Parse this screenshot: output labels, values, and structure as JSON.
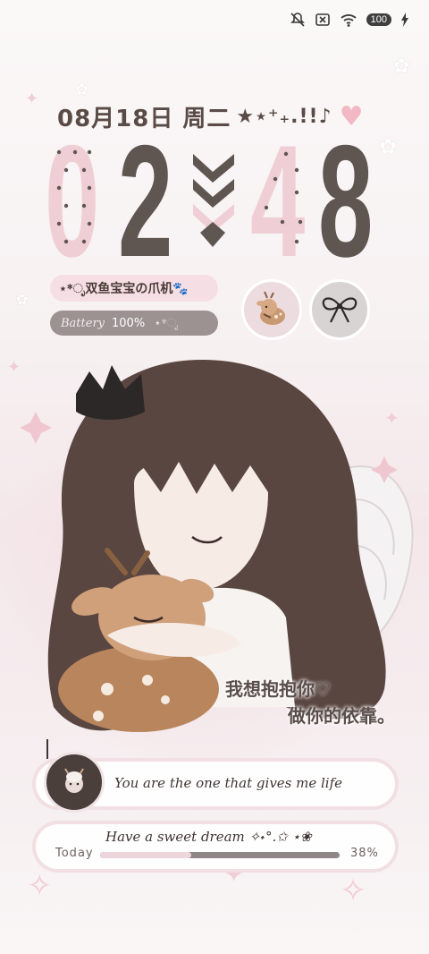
{
  "status_bar": {
    "icons": [
      "mute-icon",
      "no-sim-icon",
      "wifi-icon",
      "battery-icon",
      "charging-icon"
    ],
    "battery_level": "100"
  },
  "date": {
    "text": "08月18日 周二",
    "decoration": "★⋆⁺₊.!!♪"
  },
  "clock": {
    "hours": [
      "0",
      "2"
    ],
    "minutes": [
      "4",
      "8"
    ]
  },
  "widgets": {
    "name_label": "⋆*ೃ双鱼宝宝の爪机🐾",
    "battery_label": "Battery",
    "battery_value": "100%",
    "battery_deco": "⋆*ೃ"
  },
  "caption": {
    "line1": "我想抱抱你♡",
    "line2": "做你的依靠。"
  },
  "music": {
    "song_text": "You are the one that gives me life"
  },
  "progress": {
    "title": "Have a sweet dream ✧˖°.✩ ⋆❀",
    "today_label": "Today",
    "percent_label": "38%",
    "fraction": 0.38
  },
  "colors": {
    "pink": "#efcfd5",
    "brown": "#5f5551",
    "accent_heart": "#f2b8c3"
  }
}
